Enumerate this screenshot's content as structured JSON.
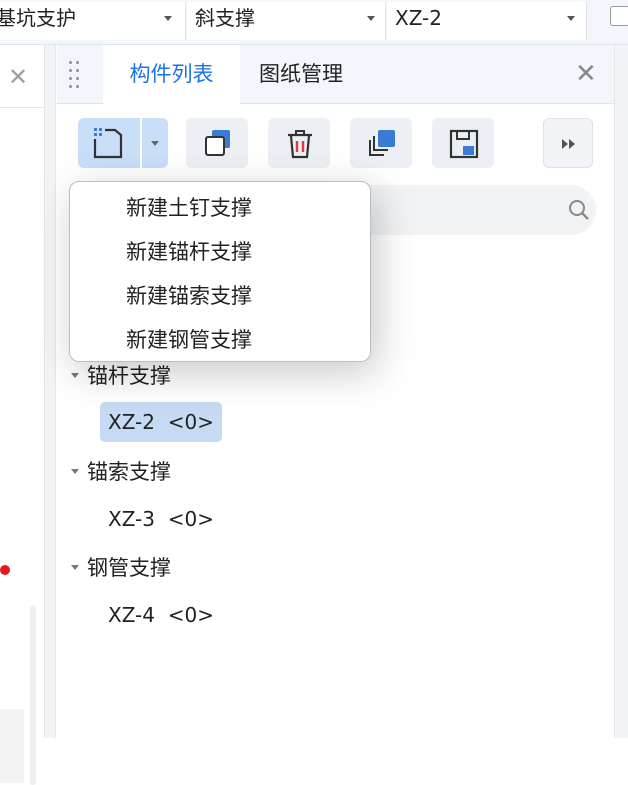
{
  "toolbar": {
    "combo1": "基坑支护",
    "combo2": "斜支撑",
    "combo3": "XZ-2"
  },
  "panel": {
    "tabs": [
      "构件列表",
      "图纸管理"
    ],
    "close_label": "✕"
  },
  "search": {
    "placeholder": ""
  },
  "menu": {
    "items": [
      "新建土钉支撑",
      "新建锚杆支撑",
      "新建锚索支撑",
      "新建钢管支撑"
    ]
  },
  "tree": {
    "groups": [
      {
        "label": "锚杆支撑",
        "items": [
          {
            "label": "XZ-2  <0>",
            "selected": true
          }
        ]
      },
      {
        "label": "锚索支撑",
        "items": [
          {
            "label": "XZ-3  <0>",
            "selected": false
          }
        ]
      },
      {
        "label": "钢管支撑",
        "items": [
          {
            "label": "XZ-4  <0>",
            "selected": false
          }
        ]
      }
    ]
  },
  "icons": {
    "new": "new-component-icon",
    "copy": "copy-icon",
    "delete": "delete-icon",
    "copy_to": "copy-to-floor-icon",
    "save": "save-icon",
    "more": "more-icon",
    "search": "search-icon",
    "close": "close-icon"
  },
  "colors": {
    "accent": "#1a73e8",
    "selected_bg": "#c7daf3",
    "danger": "#e8161e"
  }
}
